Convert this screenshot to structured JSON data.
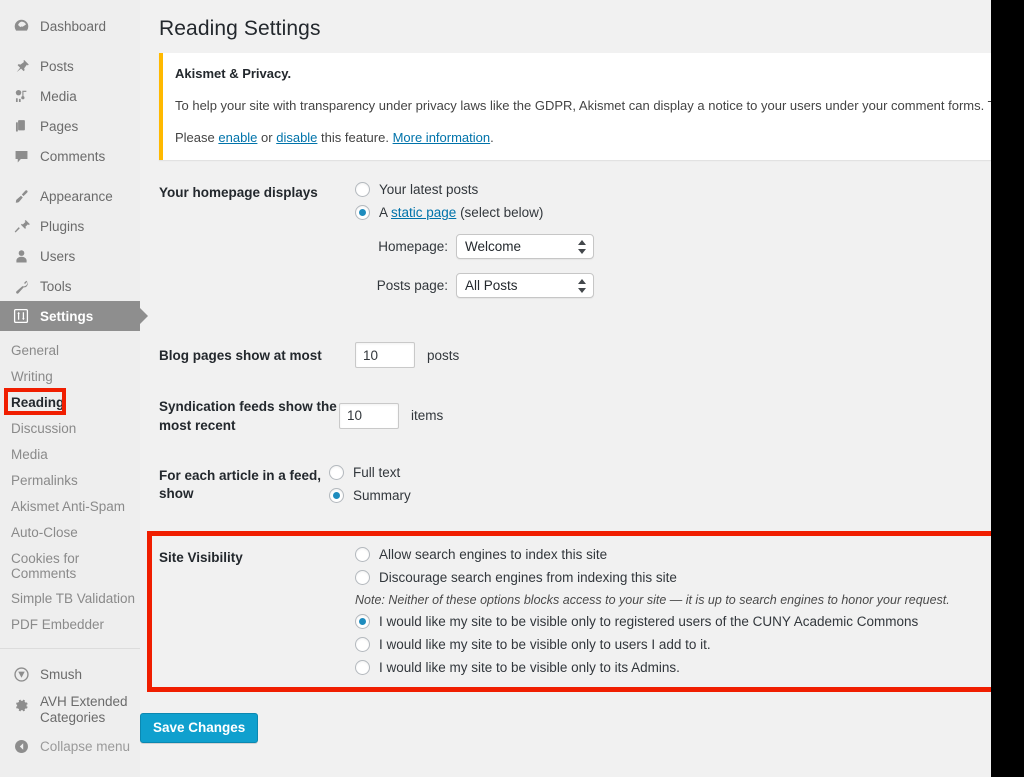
{
  "sidebar": {
    "main_items": [
      {
        "label": "Dashboard",
        "icon": "dashboard-icon",
        "active": false,
        "gap_after": true
      },
      {
        "label": "Posts",
        "icon": "pin-icon",
        "active": false,
        "gap_after": false
      },
      {
        "label": "Media",
        "icon": "media-icon",
        "active": false,
        "gap_after": false
      },
      {
        "label": "Pages",
        "icon": "pages-icon",
        "active": false,
        "gap_after": false
      },
      {
        "label": "Comments",
        "icon": "comment-bubble-icon",
        "active": false,
        "gap_after": true
      },
      {
        "label": "Appearance",
        "icon": "paintbrush-icon",
        "active": false,
        "gap_after": false
      },
      {
        "label": "Plugins",
        "icon": "plug-icon",
        "active": false,
        "gap_after": false
      },
      {
        "label": "Users",
        "icon": "user-icon",
        "active": false,
        "gap_after": false
      },
      {
        "label": "Tools",
        "icon": "wrench-icon",
        "active": false,
        "gap_after": false
      },
      {
        "label": "Settings",
        "icon": "sliders-icon",
        "active": true,
        "gap_after": false
      }
    ],
    "submenu_items": [
      {
        "label": "General",
        "current": false
      },
      {
        "label": "Writing",
        "current": false
      },
      {
        "label": "Reading",
        "current": true
      },
      {
        "label": "Discussion",
        "current": false
      },
      {
        "label": "Media",
        "current": false
      },
      {
        "label": "Permalinks",
        "current": false
      },
      {
        "label": "Akismet Anti-Spam",
        "current": false
      },
      {
        "label": "Auto-Close",
        "current": false
      },
      {
        "label": "Cookies for Comments",
        "current": false
      },
      {
        "label": "Simple TB Validation",
        "current": false
      },
      {
        "label": "PDF Embedder",
        "current": false
      }
    ],
    "bottom_items": [
      {
        "label": "Smush",
        "icon": "smush-icon"
      },
      {
        "label": "AVH Extended Categories",
        "icon": "gear-icon"
      },
      {
        "label": "Collapse menu",
        "icon": "collapse-arrow-icon"
      }
    ]
  },
  "page": {
    "title": "Reading Settings"
  },
  "notice": {
    "heading": "Akismet & Privacy.",
    "body_line": "To help your site with transparency under privacy laws like the GDPR, Akismet can display a notice to your users under your comment forms. This feature",
    "action_prefix": "Please ",
    "enable_link": "enable",
    "or_text": " or ",
    "disable_link": "disable",
    "suffix_text": " this feature. ",
    "more_info_link": "More information",
    "period": ".",
    "border_color": "#ffb900"
  },
  "homepage_section": {
    "label": "Your homepage displays",
    "options": [
      {
        "label": "Your latest posts",
        "checked": false
      },
      {
        "label_prefix": "A ",
        "link": "static page",
        "label_suffix": " (select below)",
        "checked": true
      }
    ],
    "homepage_select": {
      "label": "Homepage:",
      "value": "Welcome"
    },
    "posts_select": {
      "label": "Posts page:",
      "value": "All Posts"
    }
  },
  "blog_pages": {
    "label": "Blog pages show at most",
    "value": "10",
    "suffix": "posts"
  },
  "syndication": {
    "label": "Syndication feeds show the most recent",
    "value": "10",
    "suffix": "items"
  },
  "feed_article": {
    "label": "For each article in a feed, show",
    "options": [
      {
        "label": "Full text",
        "checked": false
      },
      {
        "label": "Summary",
        "checked": true
      }
    ]
  },
  "site_visibility": {
    "label": "Site Visibility",
    "options_top": [
      {
        "label": "Allow search engines to index this site",
        "checked": false
      },
      {
        "label": "Discourage search engines from indexing this site",
        "checked": false
      }
    ],
    "note": "Note: Neither of these options blocks access to your site — it is up to search engines to honor your request.",
    "options_bottom": [
      {
        "label": "I would like my site to be visible only to registered users of the CUNY Academic Commons",
        "checked": true
      },
      {
        "label": "I would like my site to be visible only to users I add to it.",
        "checked": false
      },
      {
        "label": "I would like my site to be visible only to its Admins.",
        "checked": false
      }
    ],
    "highlight_color": "#f01e00"
  },
  "footer": {
    "save_label": "Save Changes",
    "save_color": "#0fa0ce"
  }
}
